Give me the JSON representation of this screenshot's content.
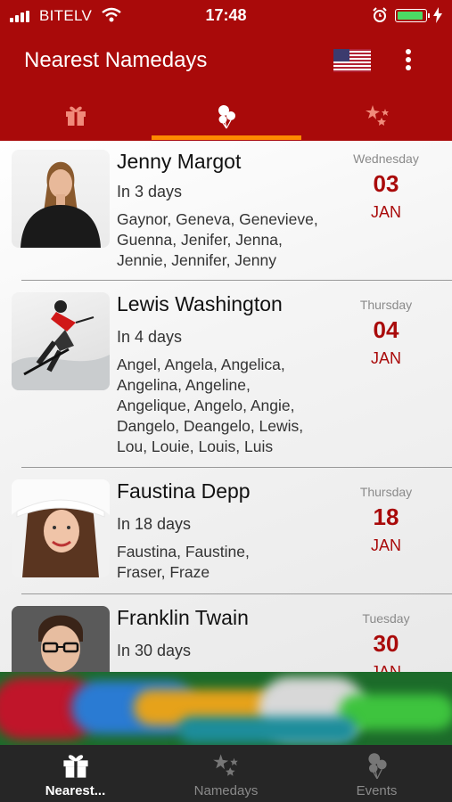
{
  "status_bar": {
    "carrier": "BITELV",
    "time": "17:48",
    "battery_level": 0.95,
    "battery_color": "#4cd964"
  },
  "app_bar": {
    "title": "Nearest Namedays",
    "flag_icon": "us-flag-icon",
    "menu_icon": "more-vertical-icon",
    "background": "#a90a0a"
  },
  "top_tabs": [
    {
      "icon": "gift-icon",
      "selected": false
    },
    {
      "icon": "balloons-icon",
      "selected": true
    },
    {
      "icon": "sparkles-icon",
      "selected": false
    }
  ],
  "accent": "#ff8a00",
  "items": [
    {
      "name": "Jenny Margot",
      "in": "In 3 days",
      "alts": [
        "Gaynor, Geneva, Genevieve,",
        "Guenna, Jenifer, Jenna,",
        "Jennie, Jennifer, Jenny"
      ],
      "weekday": "Wednesday",
      "day": "03",
      "month": "JAN"
    },
    {
      "name": "Lewis Washington",
      "in": "In 4 days",
      "alts": [
        "Angel, Angela, Angelica,",
        "Angelina, Angeline,",
        "Angelique, Angelo, Angie,",
        "Dangelo, Deangelo, Lewis,",
        "Lou, Louie, Louis, Luis"
      ],
      "weekday": "Thursday",
      "day": "04",
      "month": "JAN"
    },
    {
      "name": "Faustina Depp",
      "in": "In 18 days",
      "alts": [
        "Faustina, Faustine,",
        "Fraser, Fraze"
      ],
      "weekday": "Thursday",
      "day": "18",
      "month": "JAN"
    },
    {
      "name": "Franklin Twain",
      "in": "In 30 days",
      "alts": [],
      "weekday": "Tuesday",
      "day": "30",
      "month": "JAN"
    }
  ],
  "bottom_nav": [
    {
      "label": "Nearest...",
      "icon": "gift-icon",
      "active": true
    },
    {
      "label": "Namedays",
      "icon": "sparkles-icon",
      "active": false
    },
    {
      "label": "Events",
      "icon": "balloons-icon",
      "active": false
    }
  ]
}
